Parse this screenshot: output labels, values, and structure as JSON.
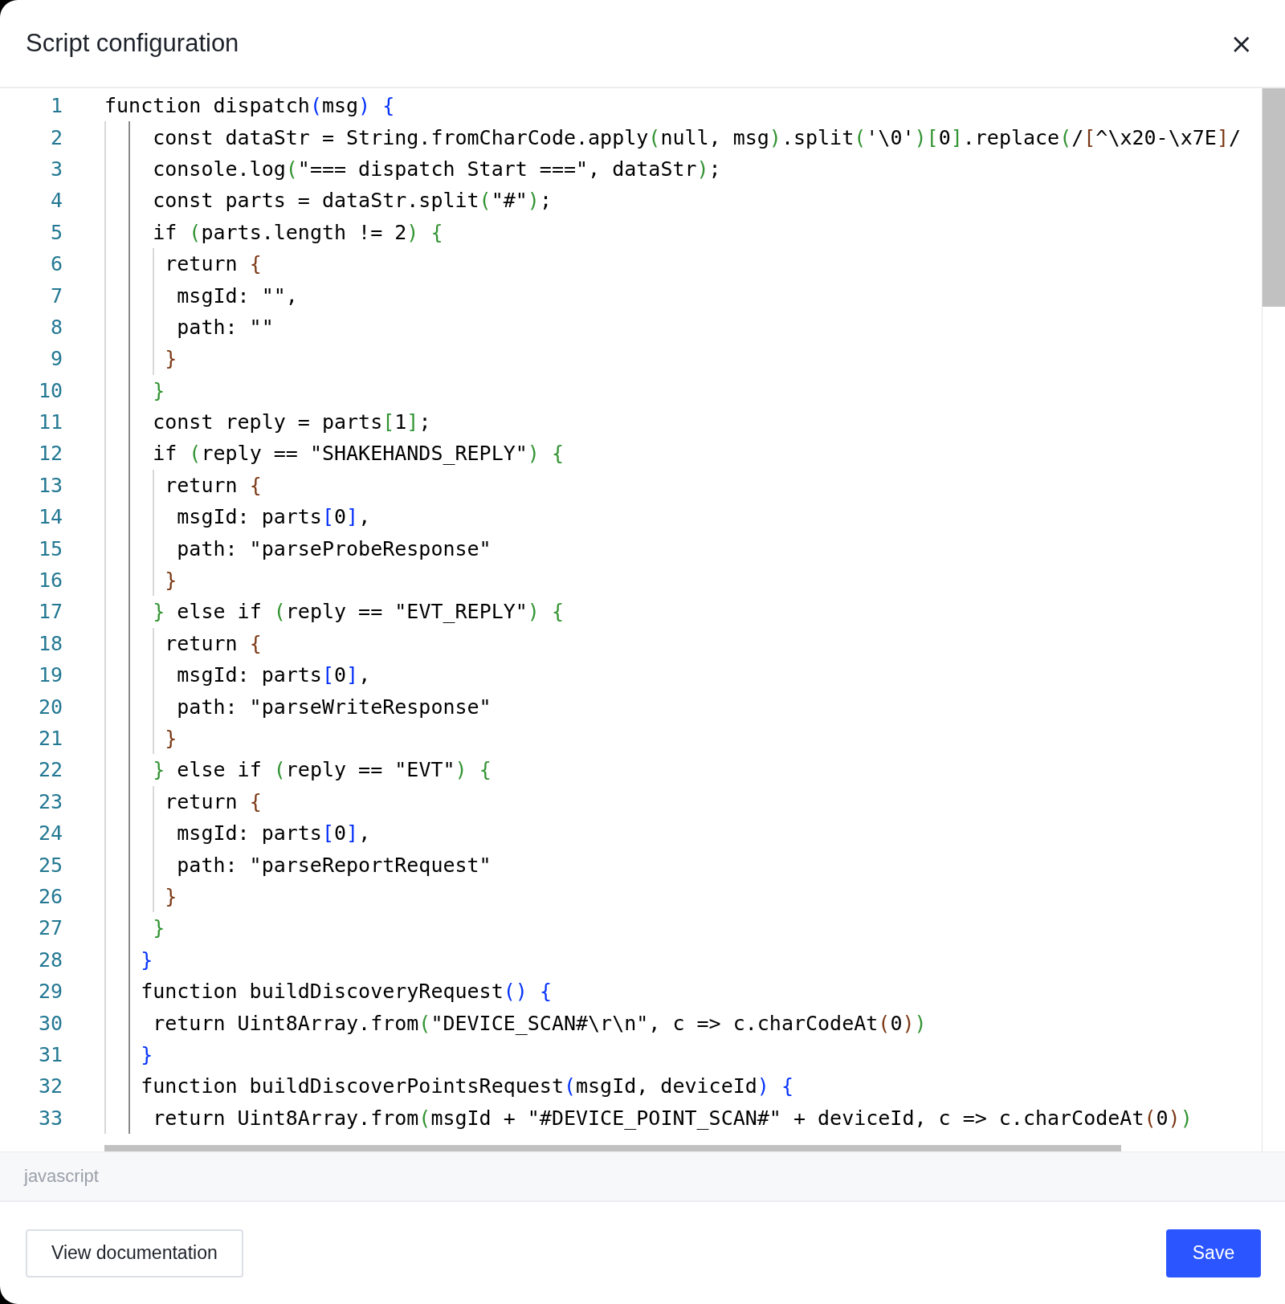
{
  "dialog": {
    "title": "Script configuration",
    "close": "×"
  },
  "editor": {
    "language": "javascript",
    "lines": [
      {
        "number": "1",
        "text": "function dispatch(msg) {"
      },
      {
        "number": "2",
        "text": "    const dataStr = String.fromCharCode.apply(null, msg).split('\\0')[0].replace(/[^\\x20-\\x7E]/"
      },
      {
        "number": "3",
        "text": "    console.log(\"=== dispatch Start ===\", dataStr);"
      },
      {
        "number": "4",
        "text": "    const parts = dataStr.split(\"#\");"
      },
      {
        "number": "5",
        "text": "    if (parts.length != 2) {"
      },
      {
        "number": "6",
        "text": "     return {"
      },
      {
        "number": "7",
        "text": "      msgId: \"\","
      },
      {
        "number": "8",
        "text": "      path: \"\""
      },
      {
        "number": "9",
        "text": "     }"
      },
      {
        "number": "10",
        "text": "    }"
      },
      {
        "number": "11",
        "text": "    const reply = parts[1];"
      },
      {
        "number": "12",
        "text": "    if (reply == \"SHAKEHANDS_REPLY\") {"
      },
      {
        "number": "13",
        "text": "     return {"
      },
      {
        "number": "14",
        "text": "      msgId: parts[0],"
      },
      {
        "number": "15",
        "text": "      path: \"parseProbeResponse\""
      },
      {
        "number": "16",
        "text": "     }"
      },
      {
        "number": "17",
        "text": "    } else if (reply == \"EVT_REPLY\") {"
      },
      {
        "number": "18",
        "text": "     return {"
      },
      {
        "number": "19",
        "text": "      msgId: parts[0],"
      },
      {
        "number": "20",
        "text": "      path: \"parseWriteResponse\""
      },
      {
        "number": "21",
        "text": "     }"
      },
      {
        "number": "22",
        "text": "    } else if (reply == \"EVT\") {"
      },
      {
        "number": "23",
        "text": "     return {"
      },
      {
        "number": "24",
        "text": "      msgId: parts[0],"
      },
      {
        "number": "25",
        "text": "      path: \"parseReportRequest\""
      },
      {
        "number": "26",
        "text": "     }"
      },
      {
        "number": "27",
        "text": "    }"
      },
      {
        "number": "28",
        "text": "   }"
      },
      {
        "number": "29",
        "text": "   function buildDiscoveryRequest() {"
      },
      {
        "number": "30",
        "text": "    return Uint8Array.from(\"DEVICE_SCAN#\\r\\n\", c => c.charCodeAt(0))"
      },
      {
        "number": "31",
        "text": "   }"
      },
      {
        "number": "32",
        "text": "   function buildDiscoverPointsRequest(msgId, deviceId) {"
      },
      {
        "number": "33",
        "text": "    return Uint8Array.from(msgId + \"#DEVICE_POINT_SCAN#\" + deviceId, c => c.charCodeAt(0))"
      }
    ]
  },
  "buttons": {
    "secondary": "View documentation",
    "primary": "Save"
  }
}
